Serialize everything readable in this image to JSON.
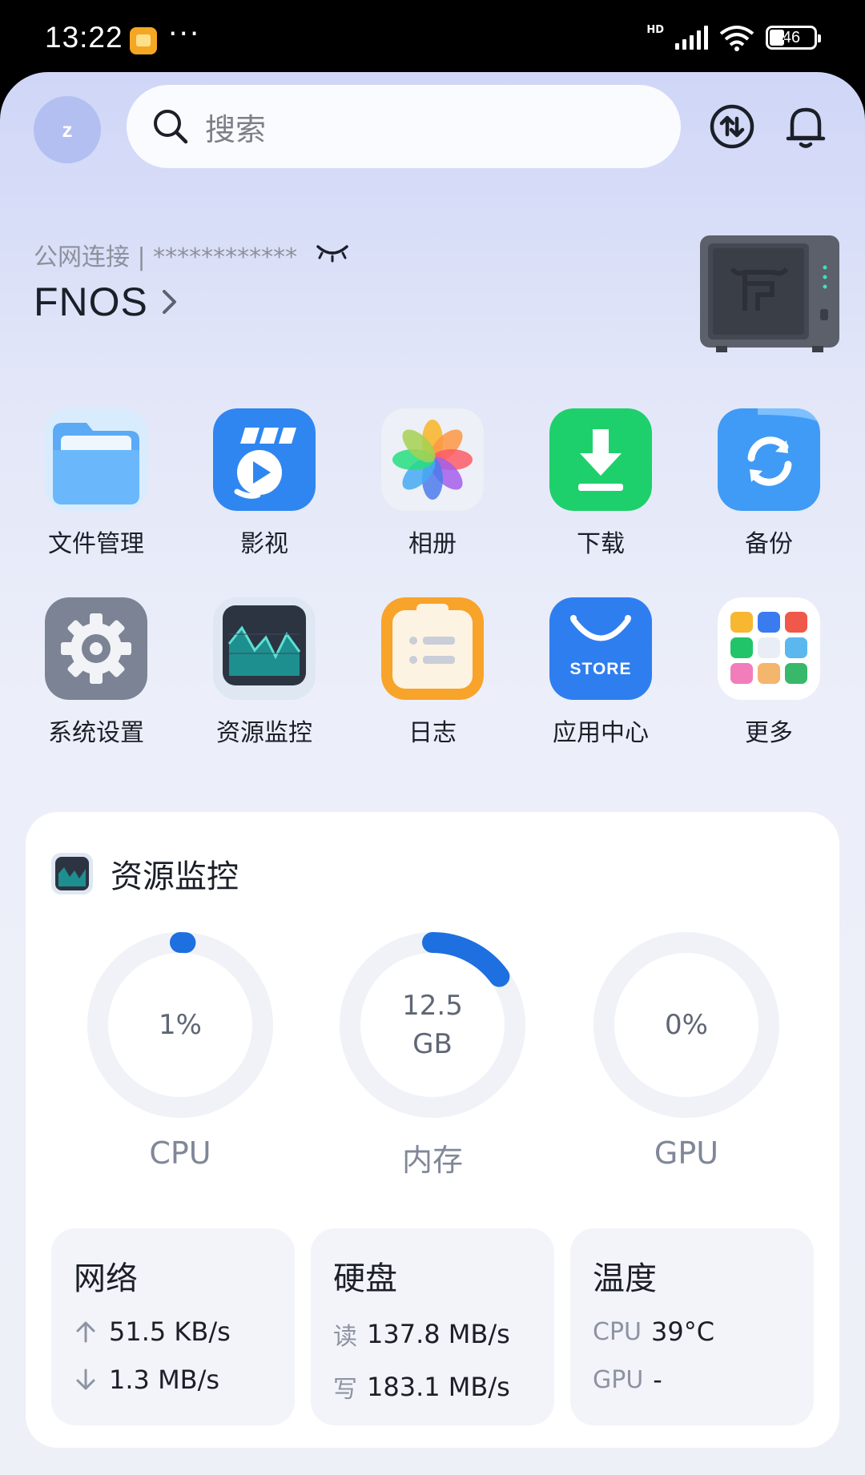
{
  "status_bar": {
    "time": "13:22",
    "dots": "···",
    "network_badge": "HD",
    "battery": "46"
  },
  "header": {
    "avatar_initial": "z",
    "search_placeholder": "搜索"
  },
  "device": {
    "connection_label": "公网连接 | ************",
    "name": "FNOS"
  },
  "apps": {
    "row1": [
      {
        "label": "文件管理",
        "icon": "folder-icon"
      },
      {
        "label": "影视",
        "icon": "video-icon"
      },
      {
        "label": "相册",
        "icon": "photos-icon"
      },
      {
        "label": "下载",
        "icon": "download-icon"
      },
      {
        "label": "备份",
        "icon": "backup-icon"
      }
    ],
    "row2": [
      {
        "label": "系统设置",
        "icon": "settings-icon"
      },
      {
        "label": "资源监控",
        "icon": "monitor-icon"
      },
      {
        "label": "日志",
        "icon": "log-icon"
      },
      {
        "label": "应用中心",
        "icon": "store-icon",
        "badge": "STORE"
      },
      {
        "label": "更多",
        "icon": "more-apps-icon"
      }
    ]
  },
  "monitor": {
    "title": "资源监控",
    "gauges": [
      {
        "label": "CPU",
        "value": "1%",
        "fraction": 0.01
      },
      {
        "label": "内存",
        "value_line1": "12.5",
        "value_line2": "GB",
        "fraction": 0.15
      },
      {
        "label": "GPU",
        "value": "0%",
        "fraction": 0
      }
    ],
    "network": {
      "title": "网络",
      "up": "51.5 KB/s",
      "down": "1.3 MB/s"
    },
    "disk": {
      "title": "硬盘",
      "read_label": "读",
      "read": "137.8 MB/s",
      "write_label": "写",
      "write": "183.1 MB/s"
    },
    "temp": {
      "title": "温度",
      "cpu_label": "CPU",
      "cpu": "39°C",
      "gpu_label": "GPU",
      "gpu": "-"
    }
  },
  "colors": {
    "accent": "#1e6fe0",
    "track": "#f0f2f7"
  }
}
